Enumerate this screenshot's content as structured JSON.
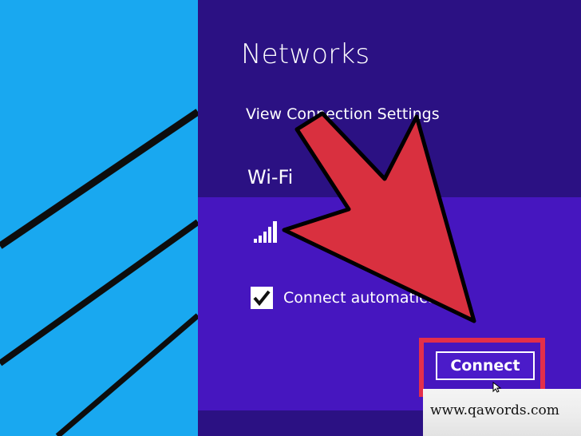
{
  "colors": {
    "desktop_bg": "#19a8f0",
    "panel_bg": "#2b1183",
    "network_item_bg": "#4616bf",
    "highlight_border": "#e42f4a",
    "arrow_fill": "#d9303f"
  },
  "panel": {
    "title": "Networks",
    "view_settings_label": "View Connection Settings",
    "section_heading": "Wi-Fi"
  },
  "network": {
    "signal_icon": "wifi-signal-bars-icon",
    "connect_automatically_label": "Connect automatically",
    "connect_automatically_checked": true,
    "connect_button_label": "Connect"
  },
  "overlay": {
    "arrow": "red-pointer-arrow",
    "watermark_text": "www.qawords.com"
  }
}
